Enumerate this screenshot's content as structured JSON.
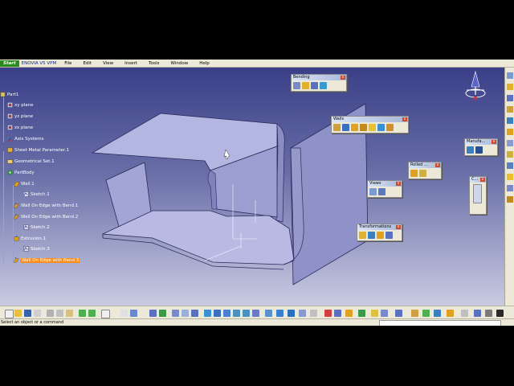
{
  "menu": {
    "start": "Start",
    "items": [
      "ENOVIA V5 VPM",
      "File",
      "Edit",
      "View",
      "Insert",
      "Tools",
      "Window",
      "Help"
    ]
  },
  "tree": {
    "root": "Part1",
    "nodes": [
      {
        "label": "xy plane",
        "icon": "plane-icon"
      },
      {
        "label": "yz plane",
        "icon": "plane-icon"
      },
      {
        "label": "zx plane",
        "icon": "plane-icon"
      },
      {
        "label": "Axis Systems",
        "icon": "axis-systems-icon"
      },
      {
        "label": "Sheet Metal Parameter.1",
        "icon": "sheet-metal-parameter-icon"
      },
      {
        "label": "Geometrical Set.1",
        "icon": "geometrical-set-icon"
      },
      {
        "label": "PartBody",
        "icon": "partbody-gear-icon"
      },
      {
        "label": "Wall.1",
        "icon": "wall-icon"
      },
      {
        "label": "Sketch.1",
        "icon": "sketch-icon"
      },
      {
        "label": "Wall On Edge with Bend.1",
        "icon": "wall-on-edge-icon"
      },
      {
        "label": "Wall On Edge with Bend.2",
        "icon": "wall-on-edge-icon"
      },
      {
        "label": "Sketch.2",
        "icon": "sketch-icon"
      },
      {
        "label": "Extrusion.1",
        "icon": "extrusion-icon"
      },
      {
        "label": "Sketch.3",
        "icon": "sketch-icon"
      },
      {
        "label": "Wall On Edge with Bend.3",
        "icon": "wall-on-edge-icon",
        "selected": true
      }
    ]
  },
  "toolbars": {
    "bending": "Bending",
    "walls": "Walls",
    "rolled": "Rolled ...",
    "views": "Views",
    "transformations": "Transformations",
    "manufacturing": "Manufa...",
    "c": "C..."
  },
  "status": {
    "prompt": "Select an object or a command"
  },
  "colors": {
    "selection": "#ff8c1a",
    "viewport_top": "#3a3f88",
    "viewport_bottom": "#c9cbe2",
    "part_face": "#9a9ccf"
  }
}
